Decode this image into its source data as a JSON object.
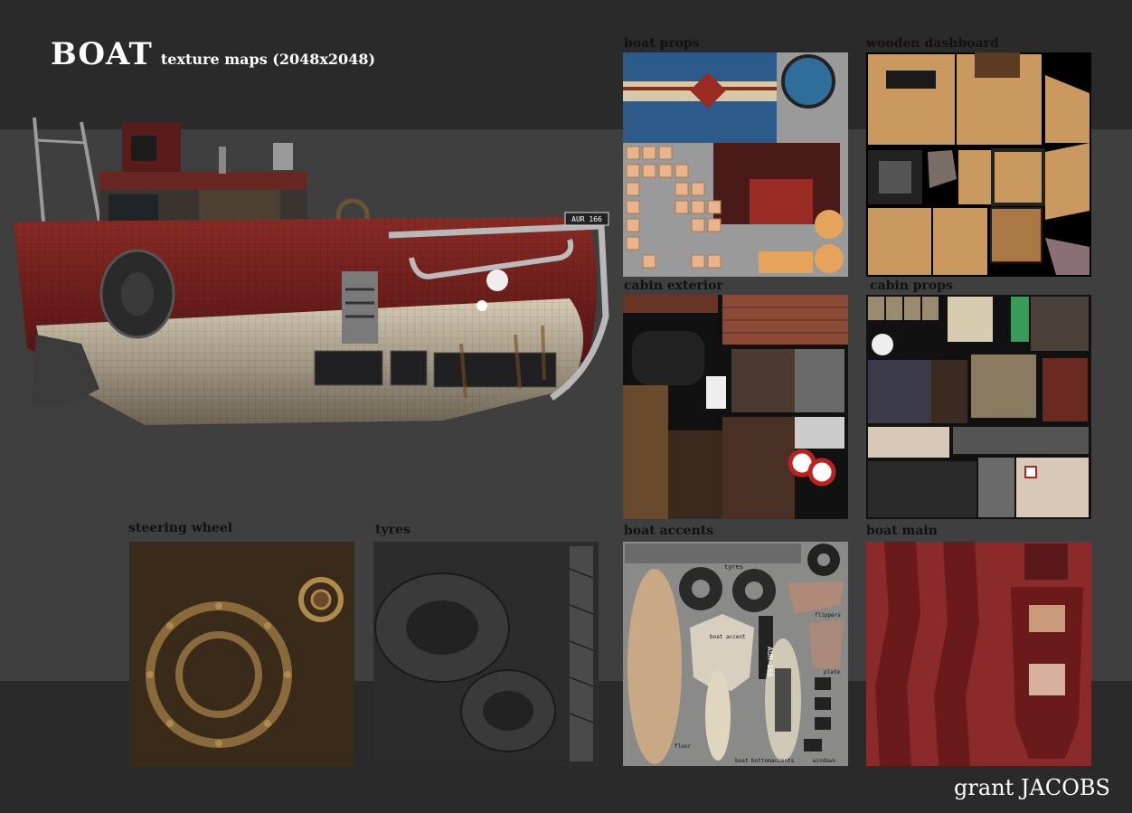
{
  "title": {
    "main": "BOAT",
    "sub": "texture maps (2048x2048)"
  },
  "boat_plate": "AUR 166",
  "maps": {
    "boat_props": "boat props",
    "wooden_dashboard": "wooden dashboard",
    "cabin_exterior": "cabin exterior",
    "cabin_props": "cabin props",
    "steering_wheel": "steering wheel",
    "tyres": "tyres",
    "boat_accents": "boat accents",
    "boat_main": "boat main"
  },
  "accent_tile_text": {
    "tyres": "tyres",
    "plate": "AUR 166",
    "boat_accent": "boat accent",
    "flippers": "flippers",
    "plate_small": "plate",
    "floor": "floor",
    "boat_bottom": "boat bottom",
    "accents": "accents",
    "windows": "windows"
  },
  "credit": "grant JACOBS",
  "colors": {
    "background_dark": "#2a2a2a",
    "background_mid": "#3f3f3f",
    "hull_red": "#7a1e1e",
    "wood": "#b8875a"
  }
}
